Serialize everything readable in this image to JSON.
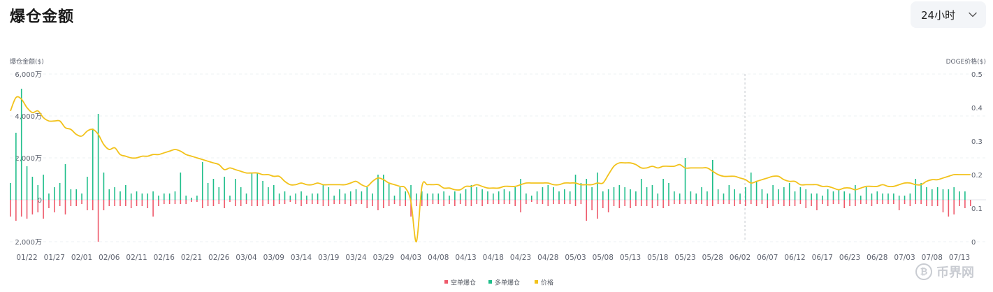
{
  "header": {
    "title": "爆仓金额",
    "range_selector": {
      "value": "24小时"
    }
  },
  "watermark": {
    "icon": "bitcoin-icon",
    "text": "币界网"
  },
  "colors": {
    "short": "#ee5a6b",
    "long": "#1fbe8a",
    "price": "#f2c21b",
    "grid": "#eef0f3",
    "axis_text": "#5f6470"
  },
  "chart_data": {
    "type": "bar+line",
    "title": "爆仓金额",
    "ylabel": "爆仓金额($)",
    "y2label": "DOGE价格($)",
    "ylim": [
      -2000,
      6000
    ],
    "y2lim": [
      0,
      0.5
    ],
    "y_ticks": [
      {
        "value": 6000,
        "label": "6,000万"
      },
      {
        "value": 4000,
        "label": "4,000万"
      },
      {
        "value": 2000,
        "label": "2,000万"
      },
      {
        "value": 0,
        "label": "0"
      },
      {
        "value": -2000,
        "label": "2,000万"
      }
    ],
    "y2_ticks": [
      {
        "value": 0.5,
        "label": "0.5"
      },
      {
        "value": 0.4,
        "label": "0.4"
      },
      {
        "value": 0.3,
        "label": "0.3"
      },
      {
        "value": 0.2,
        "label": "0.2"
      },
      {
        "value": 0.1,
        "label": "0.1"
      },
      {
        "value": 0,
        "label": "0"
      }
    ],
    "x_tick_labels": [
      "01/22",
      "01/27",
      "02/01",
      "02/06",
      "02/11",
      "02/16",
      "02/21",
      "02/26",
      "03/04",
      "03/09",
      "03/14",
      "03/19",
      "03/24",
      "03/29",
      "04/03",
      "04/08",
      "04/13",
      "04/18",
      "04/23",
      "04/28",
      "05/03",
      "05/08",
      "05/13",
      "05/18",
      "05/23",
      "05/28",
      "06/02",
      "06/07",
      "06/12",
      "06/17",
      "06/23",
      "06/28",
      "07/03",
      "07/08",
      "07/13"
    ],
    "x_tick_days": [
      3,
      8,
      13,
      18,
      23,
      28,
      33,
      38,
      43,
      48,
      53,
      58,
      63,
      68,
      73,
      78,
      83,
      88,
      93,
      98,
      103,
      108,
      113,
      118,
      123,
      128,
      133,
      138,
      143,
      148,
      153,
      158,
      163,
      168,
      173
    ],
    "start_date": "2025-01-19",
    "cursor_date": "06/02",
    "legend": [
      "空单爆仓",
      "多单爆仓",
      "价格"
    ],
    "legend_position": "bottom-center",
    "grid": true,
    "series": [
      {
        "name": "多单爆仓",
        "values": [
          800,
          3200,
          5300,
          1600,
          1100,
          700,
          1200,
          300,
          600,
          800,
          1700,
          500,
          500,
          300,
          1100,
          3400,
          4100,
          1300,
          500,
          600,
          400,
          700,
          300,
          400,
          300,
          300,
          400,
          200,
          300,
          300,
          400,
          1300,
          200,
          100,
          200,
          1800,
          800,
          1000,
          600,
          1100,
          200,
          1000,
          600,
          300,
          1300,
          1300,
          900,
          600,
          700,
          300,
          400,
          200,
          300,
          400,
          200,
          300,
          300,
          700,
          600,
          200,
          500,
          300,
          400,
          500,
          400,
          600,
          300,
          1200,
          1200,
          800,
          200,
          600,
          400,
          700,
          300,
          400,
          300,
          300,
          300,
          400,
          200,
          400,
          300,
          500,
          700,
          600,
          500,
          400,
          300,
          400,
          500,
          400,
          600,
          1000,
          300,
          200,
          400,
          600,
          700,
          600,
          400,
          500,
          400,
          1200,
          800,
          1000,
          600,
          1300,
          400,
          500,
          600,
          700,
          600,
          500,
          400,
          1000,
          600,
          700,
          300,
          1000,
          800,
          400,
          300,
          2000,
          400,
          300,
          600,
          400,
          1900,
          500,
          300,
          700,
          500,
          300,
          600,
          1300,
          900,
          500,
          300,
          700,
          500,
          600,
          800,
          400,
          600,
          500,
          300,
          300,
          200,
          500,
          400,
          500,
          400,
          300,
          700,
          200,
          600,
          300,
          400,
          300,
          300,
          300,
          200,
          200,
          300,
          1000,
          800,
          600,
          500,
          600,
          500,
          500,
          600,
          400,
          400
        ]
      },
      {
        "name": "空单爆仓",
        "values": [
          -800,
          -1000,
          -800,
          -900,
          -700,
          -600,
          -900,
          -400,
          -600,
          -300,
          -700,
          -300,
          -300,
          -200,
          -500,
          -500,
          -2000,
          -500,
          -300,
          -300,
          -300,
          -300,
          -400,
          -300,
          -300,
          -400,
          -800,
          -300,
          -200,
          -200,
          -200,
          -200,
          -200,
          -100,
          -100,
          -400,
          -300,
          -300,
          -200,
          -400,
          -100,
          -300,
          -300,
          -200,
          -300,
          -300,
          -300,
          -200,
          -300,
          -200,
          -200,
          -100,
          -200,
          -300,
          -200,
          -200,
          -200,
          -300,
          -300,
          -200,
          -200,
          -200,
          -300,
          -200,
          -200,
          -400,
          -300,
          -500,
          -400,
          -300,
          -200,
          -300,
          -300,
          -800,
          -300,
          -300,
          -300,
          -200,
          -200,
          -300,
          -200,
          -300,
          -200,
          -300,
          -300,
          -200,
          -300,
          -200,
          -200,
          -200,
          -200,
          -200,
          -300,
          -600,
          -200,
          -100,
          -200,
          -200,
          -300,
          -200,
          -200,
          -200,
          -200,
          -300,
          -200,
          -1000,
          -500,
          -900,
          -400,
          -600,
          -300,
          -400,
          -300,
          -400,
          -300,
          -300,
          -300,
          -400,
          -300,
          -400,
          -300,
          -200,
          -200,
          -200,
          -200,
          -200,
          -200,
          -300,
          -300,
          -200,
          -200,
          -200,
          -300,
          -200,
          -300,
          -200,
          -300,
          -200,
          -400,
          -300,
          -200,
          -300,
          -300,
          -300,
          -200,
          -400,
          -300,
          -500,
          -200,
          -300,
          -200,
          -200,
          -400,
          -300,
          -300,
          -200,
          -200,
          -300,
          -200,
          -200,
          -200,
          -200,
          -500,
          -200,
          -300,
          -200,
          -200,
          -300,
          -300,
          -300,
          -600,
          -800,
          -700,
          -300,
          -400,
          -300
        ]
      },
      {
        "name": "价格",
        "points": [
          [
            0,
            0.39
          ],
          [
            1,
            0.43
          ],
          [
            2,
            0.425
          ],
          [
            3,
            0.4
          ],
          [
            4,
            0.385
          ],
          [
            5,
            0.39
          ],
          [
            6,
            0.37
          ],
          [
            7,
            0.36
          ],
          [
            8,
            0.36
          ],
          [
            9,
            0.36
          ],
          [
            10,
            0.34
          ],
          [
            11,
            0.335
          ],
          [
            12,
            0.32
          ],
          [
            13,
            0.315
          ],
          [
            14,
            0.33
          ],
          [
            15,
            0.335
          ],
          [
            16,
            0.32
          ],
          [
            17,
            0.29
          ],
          [
            18,
            0.275
          ],
          [
            19,
            0.28
          ],
          [
            20,
            0.26
          ],
          [
            21,
            0.255
          ],
          [
            22,
            0.25
          ],
          [
            23,
            0.25
          ],
          [
            24,
            0.255
          ],
          [
            25,
            0.255
          ],
          [
            26,
            0.26
          ],
          [
            27,
            0.26
          ],
          [
            28,
            0.265
          ],
          [
            29,
            0.27
          ],
          [
            30,
            0.275
          ],
          [
            31,
            0.27
          ],
          [
            32,
            0.26
          ],
          [
            33,
            0.255
          ],
          [
            34,
            0.25
          ],
          [
            35,
            0.245
          ],
          [
            36,
            0.24
          ],
          [
            37,
            0.235
          ],
          [
            38,
            0.23
          ],
          [
            39,
            0.215
          ],
          [
            40,
            0.22
          ],
          [
            41,
            0.215
          ],
          [
            42,
            0.21
          ],
          [
            43,
            0.205
          ],
          [
            44,
            0.205
          ],
          [
            45,
            0.205
          ],
          [
            46,
            0.2
          ],
          [
            47,
            0.2
          ],
          [
            48,
            0.195
          ],
          [
            49,
            0.195
          ],
          [
            50,
            0.18
          ],
          [
            51,
            0.17
          ],
          [
            52,
            0.17
          ],
          [
            53,
            0.175
          ],
          [
            54,
            0.17
          ],
          [
            55,
            0.17
          ],
          [
            56,
            0.175
          ],
          [
            57,
            0.17
          ],
          [
            58,
            0.17
          ],
          [
            59,
            0.17
          ],
          [
            60,
            0.17
          ],
          [
            61,
            0.17
          ],
          [
            62,
            0.175
          ],
          [
            63,
            0.18
          ],
          [
            64,
            0.17
          ],
          [
            65,
            0.165
          ],
          [
            66,
            0.18
          ],
          [
            67,
            0.19
          ],
          [
            68,
            0.185
          ],
          [
            69,
            0.175
          ],
          [
            70,
            0.17
          ],
          [
            71,
            0.165
          ],
          [
            72,
            0.16
          ],
          [
            73,
            0.12
          ],
          [
            74,
            0.0
          ],
          [
            75,
            0.165
          ],
          [
            76,
            0.17
          ],
          [
            77,
            0.17
          ],
          [
            78,
            0.17
          ],
          [
            79,
            0.16
          ],
          [
            80,
            0.16
          ],
          [
            81,
            0.155
          ],
          [
            82,
            0.155
          ],
          [
            83,
            0.165
          ],
          [
            84,
            0.165
          ],
          [
            85,
            0.17
          ],
          [
            86,
            0.165
          ],
          [
            87,
            0.16
          ],
          [
            88,
            0.16
          ],
          [
            89,
            0.16
          ],
          [
            90,
            0.165
          ],
          [
            91,
            0.165
          ],
          [
            92,
            0.165
          ],
          [
            93,
            0.17
          ],
          [
            94,
            0.175
          ],
          [
            95,
            0.175
          ],
          [
            96,
            0.175
          ],
          [
            97,
            0.175
          ],
          [
            98,
            0.175
          ],
          [
            99,
            0.17
          ],
          [
            100,
            0.17
          ],
          [
            101,
            0.175
          ],
          [
            102,
            0.175
          ],
          [
            103,
            0.175
          ],
          [
            104,
            0.17
          ],
          [
            105,
            0.17
          ],
          [
            106,
            0.17
          ],
          [
            107,
            0.175
          ],
          [
            108,
            0.175
          ],
          [
            109,
            0.2
          ],
          [
            110,
            0.225
          ],
          [
            111,
            0.235
          ],
          [
            112,
            0.235
          ],
          [
            113,
            0.235
          ],
          [
            114,
            0.23
          ],
          [
            115,
            0.22
          ],
          [
            116,
            0.22
          ],
          [
            117,
            0.225
          ],
          [
            118,
            0.22
          ],
          [
            119,
            0.225
          ],
          [
            120,
            0.225
          ],
          [
            121,
            0.225
          ],
          [
            122,
            0.23
          ],
          [
            123,
            0.22
          ],
          [
            124,
            0.22
          ],
          [
            125,
            0.22
          ],
          [
            126,
            0.22
          ],
          [
            127,
            0.22
          ],
          [
            128,
            0.21
          ],
          [
            129,
            0.2
          ],
          [
            130,
            0.195
          ],
          [
            131,
            0.195
          ],
          [
            132,
            0.195
          ],
          [
            133,
            0.19
          ],
          [
            134,
            0.185
          ],
          [
            135,
            0.175
          ],
          [
            136,
            0.18
          ],
          [
            137,
            0.185
          ],
          [
            138,
            0.19
          ],
          [
            139,
            0.195
          ],
          [
            140,
            0.195
          ],
          [
            141,
            0.185
          ],
          [
            142,
            0.18
          ],
          [
            143,
            0.18
          ],
          [
            144,
            0.17
          ],
          [
            145,
            0.17
          ],
          [
            146,
            0.17
          ],
          [
            147,
            0.17
          ],
          [
            148,
            0.165
          ],
          [
            149,
            0.165
          ],
          [
            150,
            0.16
          ],
          [
            151,
            0.155
          ],
          [
            152,
            0.16
          ],
          [
            153,
            0.16
          ],
          [
            154,
            0.155
          ],
          [
            155,
            0.16
          ],
          [
            156,
            0.165
          ],
          [
            157,
            0.165
          ],
          [
            158,
            0.165
          ],
          [
            159,
            0.17
          ],
          [
            160,
            0.165
          ],
          [
            161,
            0.165
          ],
          [
            162,
            0.17
          ],
          [
            163,
            0.175
          ],
          [
            164,
            0.175
          ],
          [
            165,
            0.17
          ],
          [
            166,
            0.17
          ],
          [
            167,
            0.18
          ],
          [
            168,
            0.185
          ],
          [
            169,
            0.185
          ],
          [
            170,
            0.19
          ],
          [
            171,
            0.195
          ],
          [
            172,
            0.2
          ],
          [
            173,
            0.2
          ],
          [
            174,
            0.2
          ],
          [
            175,
            0.2
          ]
        ]
      }
    ]
  }
}
